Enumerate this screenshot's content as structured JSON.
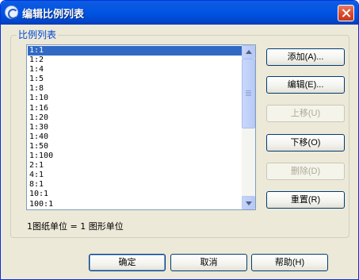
{
  "window": {
    "title": "编辑比例列表"
  },
  "group": {
    "label": "比例列表"
  },
  "list": {
    "items": [
      "1:1",
      "1:2",
      "1:4",
      "1:5",
      "1:8",
      "1:10",
      "1:16",
      "1:20",
      "1:30",
      "1:40",
      "1:50",
      "1:100",
      "2:1",
      "4:1",
      "8:1",
      "10:1",
      "100:1"
    ],
    "selected_index": 0
  },
  "buttons": {
    "add": "添加(A)...",
    "edit": "编辑(E)...",
    "move_up": "上移(U)",
    "move_down": "下移(O)",
    "delete": "删除(D)",
    "reset": "重置(R)",
    "ok": "确定",
    "cancel": "取消",
    "help": "帮助(H)"
  },
  "ratio_text": "1图纸单位 = 1 图形单位",
  "icons": {
    "app": "autocad-app-icon",
    "close": "close-icon",
    "scroll_up": "scroll-up-arrow-icon",
    "scroll_down": "scroll-down-arrow-icon"
  },
  "colors": {
    "title_bar": "#0054e3",
    "window_bg": "#ece9d8",
    "selection": "#316ac5",
    "group_label": "#0046d5",
    "close_button": "#d6472a"
  }
}
